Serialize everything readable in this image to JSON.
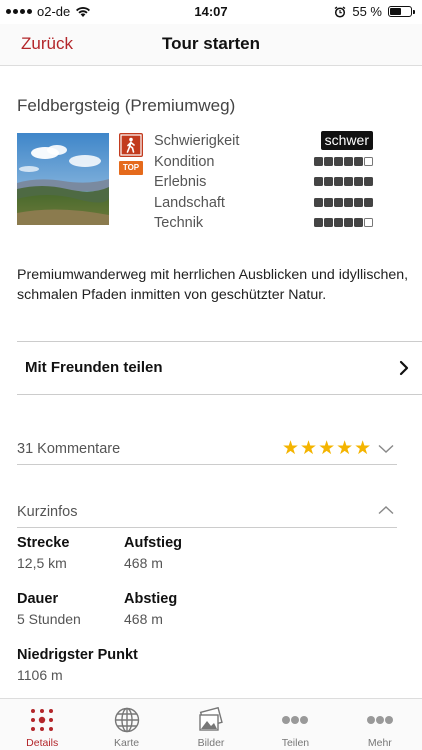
{
  "status_bar": {
    "carrier": "o2-de",
    "time": "14:07",
    "battery": "55 %"
  },
  "nav": {
    "back_label": "Zurück",
    "title": "Tour starten"
  },
  "tour": {
    "title": "Feldbergsteig (Premiumweg)",
    "top_badge": "TOP",
    "ratings": [
      {
        "label": "Schwierigkeit",
        "value_text": "schwer"
      },
      {
        "label": "Kondition",
        "filled": 5,
        "max": 6
      },
      {
        "label": "Erlebnis",
        "filled": 6,
        "max": 6
      },
      {
        "label": "Landschaft",
        "filled": 6,
        "max": 6
      },
      {
        "label": "Technik",
        "filled": 5,
        "max": 6
      }
    ],
    "description": "Premiumwanderweg mit herrlichen Ausblicken und idyllischen, schmalen Pfaden inmitten von geschützter Natur."
  },
  "share": {
    "label": "Mit Freunden teilen"
  },
  "comments": {
    "label": "31 Kommentare",
    "stars": "★★★★★",
    "rating": 5
  },
  "kurzinfos": {
    "label": "Kurzinfos",
    "items": [
      {
        "key": "Strecke",
        "value": "12,5 km"
      },
      {
        "key": "Aufstieg",
        "value": "468 m"
      },
      {
        "key": "Dauer",
        "value": "5 Stunden"
      },
      {
        "key": "Abstieg",
        "value": "468 m"
      },
      {
        "key": "Niedrigster Punkt",
        "value": "1106 m"
      }
    ]
  },
  "tabs": [
    {
      "label": "Details",
      "icon": "details-icon",
      "active": true
    },
    {
      "label": "Karte",
      "icon": "globe-icon"
    },
    {
      "label": "Bilder",
      "icon": "pictures-icon"
    },
    {
      "label": "Teilen",
      "icon": "share-dots-icon"
    },
    {
      "label": "Mehr",
      "icon": "more-dots-icon"
    }
  ],
  "colors": {
    "accent": "#b3262a",
    "stars": "#f4b400",
    "hike_icon_bg": "#c23b1e",
    "top_badge_bg": "#e56a1c"
  }
}
